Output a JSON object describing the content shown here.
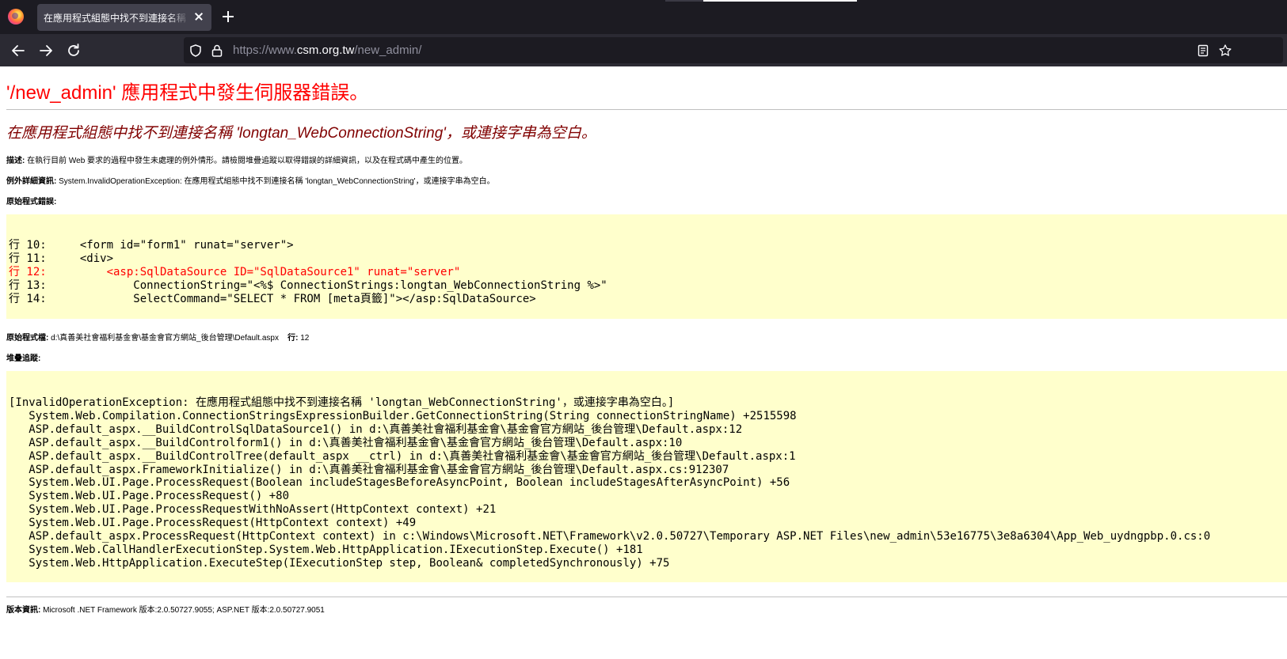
{
  "browser": {
    "tab_title": "在應用程式組態中找不到連接名稱 'longtan_WebConnectionString'",
    "url_prefix": "https://www.",
    "url_host": "csm.org.tw",
    "url_path": "/new_admin/"
  },
  "page": {
    "heading_app": "'/new_admin'",
    "heading_text": " 應用程式中發生伺服器錯誤。",
    "error_title_pre": "在應用程式組態中找不到連接名稱 ",
    "error_title_name": "'longtan_WebConnectionString'",
    "error_title_post": "，或連接字串為空白。",
    "description_label": "描述:",
    "description_text": " 在執行目前 Web 要求的過程中發生未處理的例外情形。請檢閱堆疊追蹤以取得錯誤的詳細資訊，以及在程式碼中產生的位置。",
    "exception_label": "例外詳細資訊:",
    "exception_text": " System.InvalidOperationException: 在應用程式組態中找不到連接名稱 'longtan_WebConnectionString'，或連接字串為空白。",
    "source_error_label": "原始程式錯誤:",
    "source_lines": [
      {
        "text": "行 10:     <form id=\"form1\" runat=\"server\">",
        "error": false
      },
      {
        "text": "行 11:     <div>",
        "error": false
      },
      {
        "text": "行 12:         <asp:SqlDataSource ID=\"SqlDataSource1\" runat=\"server\"",
        "error": true
      },
      {
        "text": "行 13:             ConnectionString=\"<%$ ConnectionStrings:longtan_WebConnectionString %>\"",
        "error": false
      },
      {
        "text": "行 14:             SelectCommand=\"SELECT * FROM [meta頁籤]\"></asp:SqlDataSource>",
        "error": false
      }
    ],
    "source_file_label": "原始程式檔:",
    "source_file_path": " d:\\真善美社會福利基金會\\基金會官方網站_後台管理\\Default.aspx",
    "line_label": "行:",
    "line_number": " 12",
    "stack_trace_label": "堆疊追蹤:",
    "stack_lines": [
      "[InvalidOperationException: 在應用程式組態中找不到連接名稱 'longtan_WebConnectionString'，或連接字串為空白。]",
      "   System.Web.Compilation.ConnectionStringsExpressionBuilder.GetConnectionString(String connectionStringName) +2515598",
      "   ASP.default_aspx.__BuildControlSqlDataSource1() in d:\\真善美社會福利基金會\\基金會官方網站_後台管理\\Default.aspx:12",
      "   ASP.default_aspx.__BuildControlform1() in d:\\真善美社會福利基金會\\基金會官方網站_後台管理\\Default.aspx:10",
      "   ASP.default_aspx.__BuildControlTree(default_aspx __ctrl) in d:\\真善美社會福利基金會\\基金會官方網站_後台管理\\Default.aspx:1",
      "   ASP.default_aspx.FrameworkInitialize() in d:\\真善美社會福利基金會\\基金會官方網站_後台管理\\Default.aspx.cs:912307",
      "   System.Web.UI.Page.ProcessRequest(Boolean includeStagesBeforeAsyncPoint, Boolean includeStagesAfterAsyncPoint) +56",
      "   System.Web.UI.Page.ProcessRequest() +80",
      "   System.Web.UI.Page.ProcessRequestWithNoAssert(HttpContext context) +21",
      "   System.Web.UI.Page.ProcessRequest(HttpContext context) +49",
      "   ASP.default_aspx.ProcessRequest(HttpContext context) in c:\\Windows\\Microsoft.NET\\Framework\\v2.0.50727\\Temporary ASP.NET Files\\new_admin\\53e16775\\3e8a6304\\App_Web_uydngpbp.0.cs:0",
      "   System.Web.CallHandlerExecutionStep.System.Web.HttpApplication.IExecutionStep.Execute() +181",
      "   System.Web.HttpApplication.ExecuteStep(IExecutionStep step, Boolean& completedSynchronously) +75"
    ],
    "version_label": "版本資訊:",
    "version_text": " Microsoft .NET Framework 版本:2.0.50727.9055; ASP.NET 版本:2.0.50727.9051"
  }
}
